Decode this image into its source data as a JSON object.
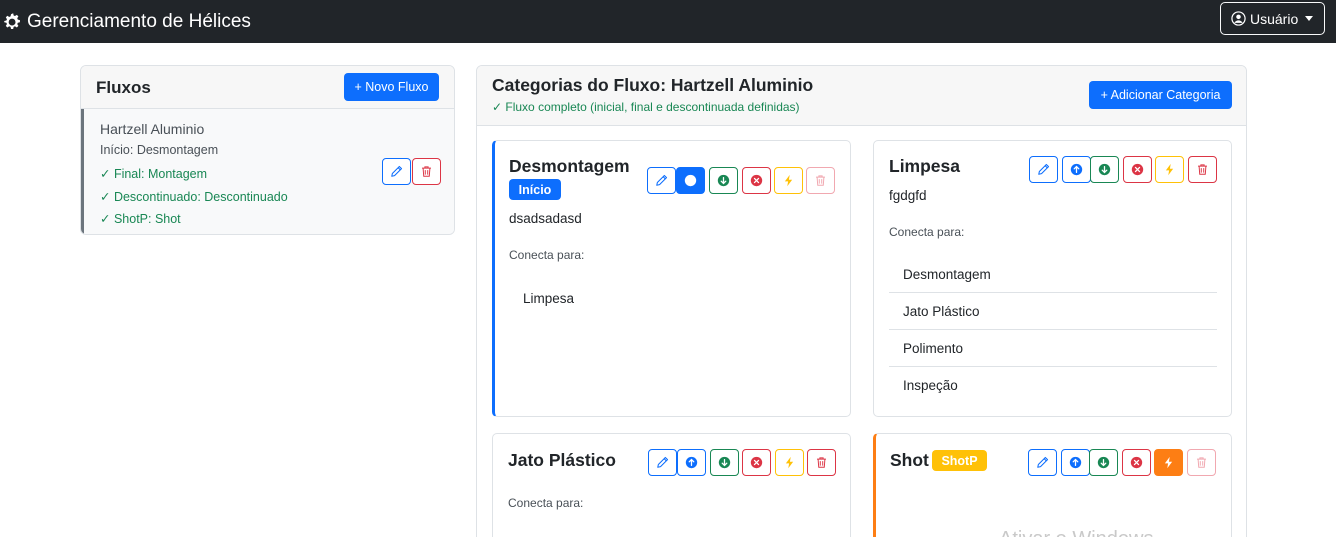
{
  "navbar": {
    "brand_icon": "gear-icon",
    "title": "Gerenciamento de Hélices",
    "user_icon": "user-circle-icon",
    "user_label": "Usuário"
  },
  "fluxos": {
    "title": "Fluxos",
    "new_button": "+ Novo Fluxo",
    "item": {
      "name": "Hartzell Aluminio",
      "inicio": "Início: Desmontagem",
      "final": "✓ Final: Montagem",
      "descontinuado": "✓ Descontinuado: Descontinuado",
      "shotp": "✓ ShotP: Shot"
    }
  },
  "categorias": {
    "title": "Categorias do Fluxo: Hartzell Aluminio",
    "status": "✓ Fluxo completo (inicial, final e descontinuada definidas)",
    "add_button": "+ Adicionar Categoria",
    "connects_label": "Conecta para:",
    "cards": [
      {
        "title": "Desmontagem",
        "badge": "Início",
        "description": "dsadsadasd",
        "connections": [
          "Limpesa"
        ]
      },
      {
        "title": "Limpesa",
        "description": "fgdgfd",
        "connections": [
          "Desmontagem",
          "Jato Plástico",
          "Polimento",
          "Inspeção"
        ]
      },
      {
        "title": "Jato Plástico",
        "connections": []
      },
      {
        "title": "Shot",
        "badge": "ShotP",
        "connections": []
      }
    ]
  },
  "colors": {
    "primary": "#0d6efd",
    "success": "#198754",
    "danger": "#dc3545",
    "warning": "#ffc107",
    "orange": "#fd7e14"
  },
  "watermark": "Ativar o Windows"
}
